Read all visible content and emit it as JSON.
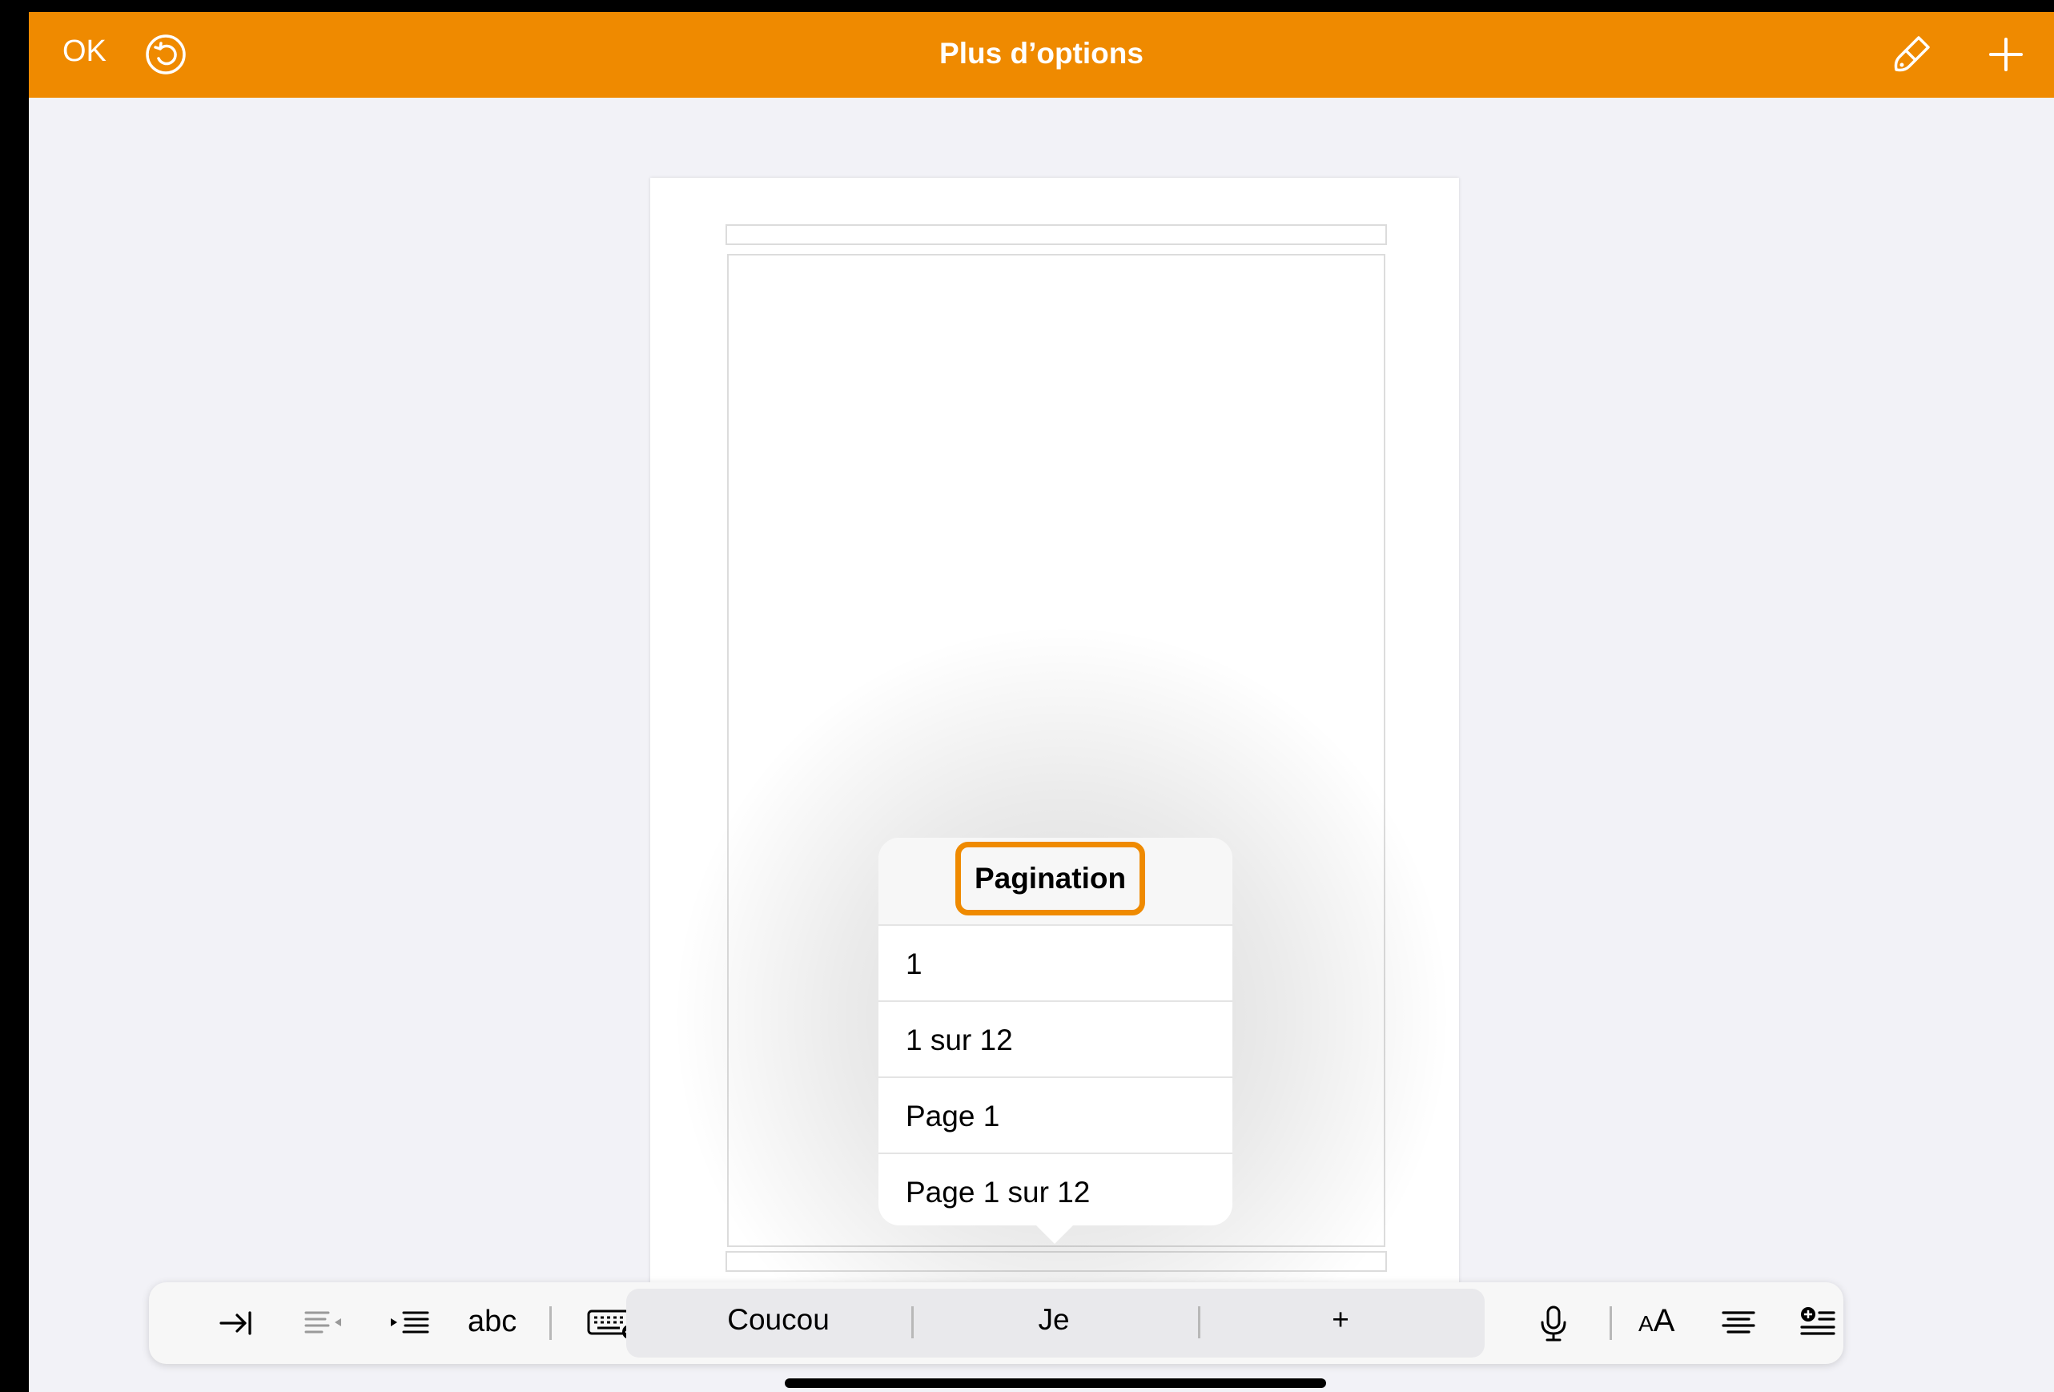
{
  "navbar": {
    "ok_label": "OK",
    "title": "Plus d’options",
    "undo_icon": "undo-circle-icon",
    "brush_icon": "paintbrush-icon",
    "plus_icon": "plus-icon",
    "color": "#ef8a00"
  },
  "popover": {
    "title": "Pagination",
    "items": [
      {
        "label": "1"
      },
      {
        "label": "1 sur 12"
      },
      {
        "label": "Page 1"
      },
      {
        "label": "Page 1 sur 12"
      }
    ]
  },
  "toolbar": {
    "abc_label": "abc",
    "suggestions": [
      "Coucou",
      "Je",
      "+"
    ],
    "icons": [
      "tab-icon",
      "outdent-icon",
      "indent-icon",
      "keyboard-icon",
      "microphone-icon",
      "font-size-icon",
      "align-center-icon",
      "insert-list-icon"
    ],
    "font_size_label_small": "A",
    "font_size_label_large": "A"
  },
  "colors": {
    "accent": "#ef8a00",
    "background": "#f2f2f7"
  }
}
